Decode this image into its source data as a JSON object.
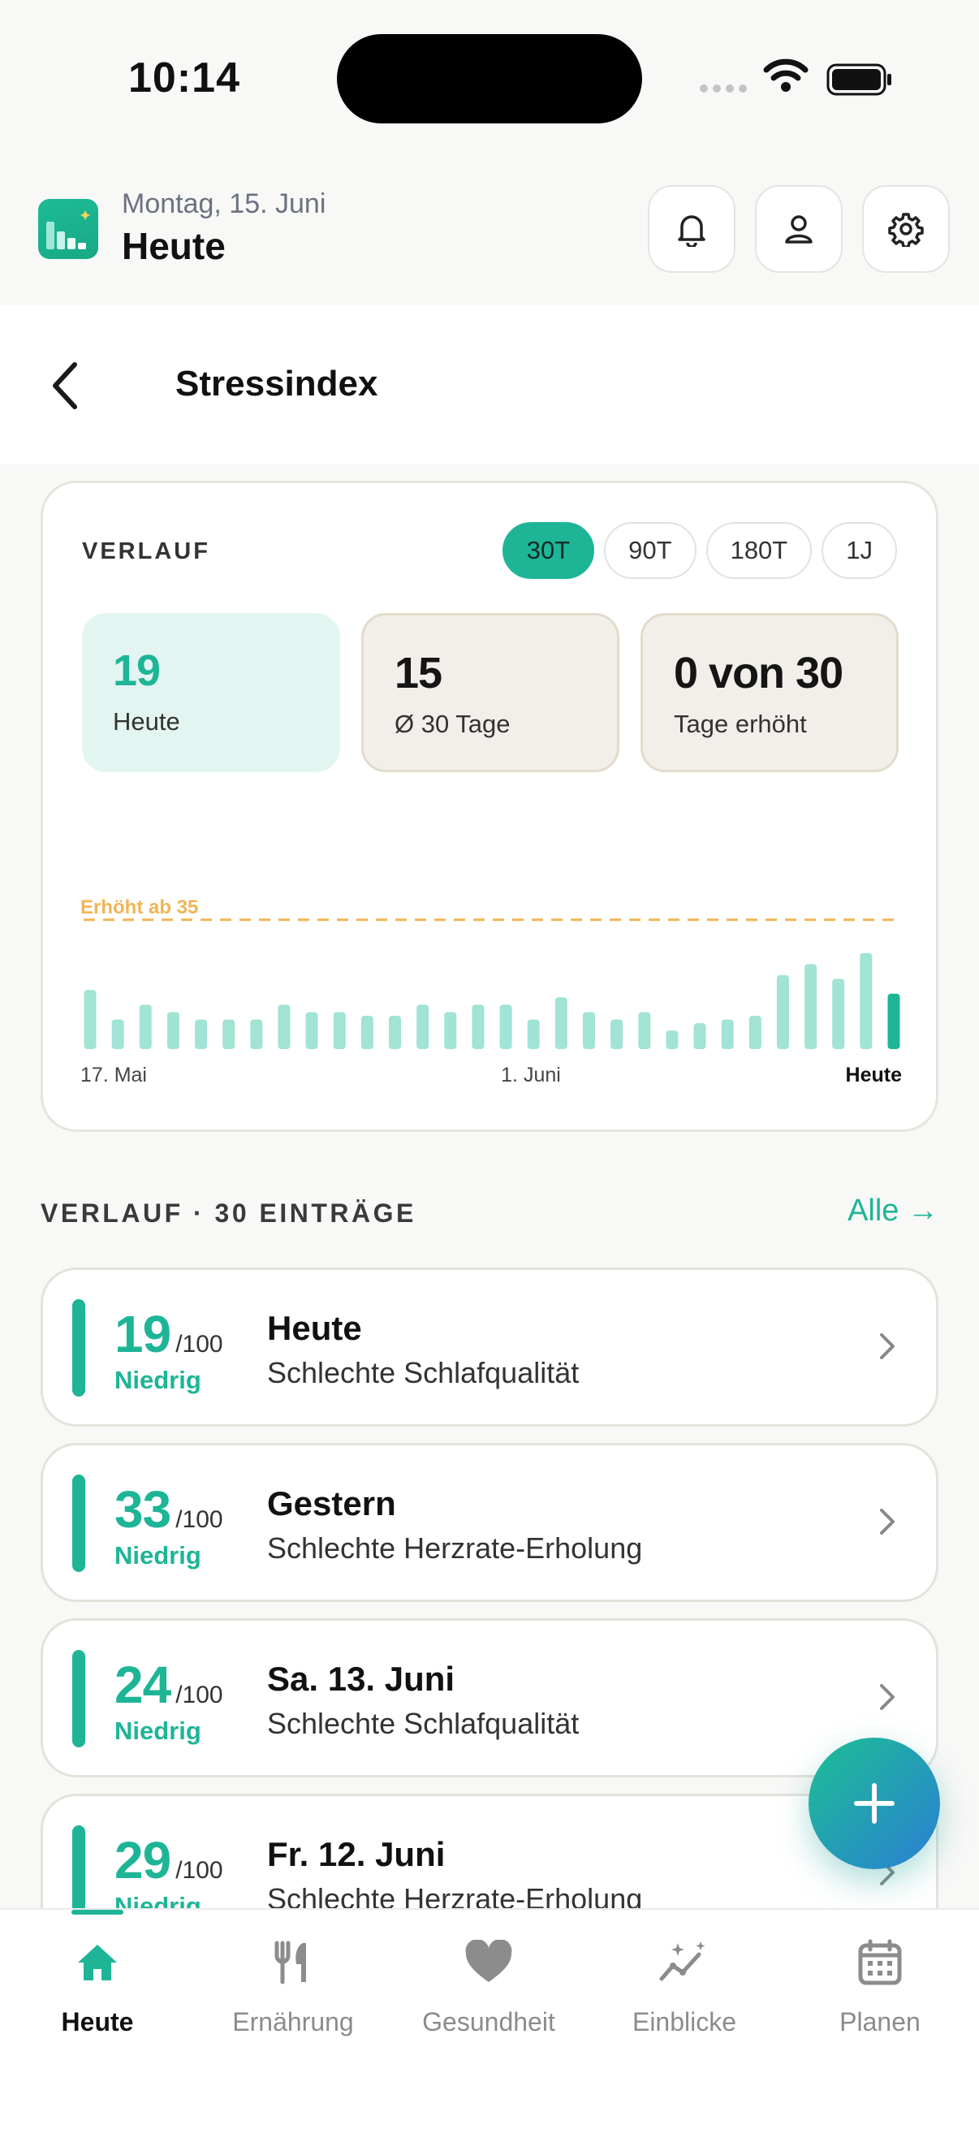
{
  "status_bar": {
    "time": "10:14",
    "icons": [
      "cellular-dots-icon",
      "wifi-icon",
      "battery-icon"
    ]
  },
  "app_header": {
    "date": "Montag, 15. Juni",
    "title": "Heute",
    "icons": [
      "app-logo",
      "bell-icon",
      "user-icon",
      "gear-icon"
    ]
  },
  "sub_header": {
    "title": "Stressindex",
    "back_icon": "chevron-left-icon"
  },
  "history_card": {
    "label": "VERLAUF",
    "ranges": [
      {
        "label": "30T",
        "active": true
      },
      {
        "label": "90T",
        "active": false
      },
      {
        "label": "180T",
        "active": false
      },
      {
        "label": "1J",
        "active": false
      }
    ],
    "stats": [
      {
        "value": "19",
        "label": "Heute"
      },
      {
        "value": "15",
        "label": "Ø 30 Tage"
      },
      {
        "value": "0 von 30",
        "label": "Tage erhöht"
      }
    ]
  },
  "chart_data": {
    "type": "bar",
    "threshold": {
      "value": 35,
      "label": "Erhöht ab 35"
    },
    "x_labels": [
      "17. Mai",
      "1. Juni",
      "Heute"
    ],
    "values": [
      16,
      8,
      12,
      10,
      8,
      8,
      8,
      12,
      10,
      10,
      9,
      9,
      12,
      10,
      12,
      12,
      8,
      14,
      10,
      8,
      10,
      5,
      7,
      8,
      9,
      20,
      23,
      19,
      26,
      15
    ],
    "colors": {
      "bar": "#a1e3d4",
      "today": "#1eb597",
      "threshold": "#f0b556"
    }
  },
  "list": {
    "header": "VERLAUF · 30 EINTRÄGE",
    "all_link": "Alle →",
    "entries": [
      {
        "score": "19",
        "max": "/100",
        "level": "Niedrig",
        "title": "Heute",
        "reason": "Schlechte Schlafqualität"
      },
      {
        "score": "33",
        "max": "/100",
        "level": "Niedrig",
        "title": "Gestern",
        "reason": "Schlechte Herzrate-Erholung"
      },
      {
        "score": "24",
        "max": "/100",
        "level": "Niedrig",
        "title": "Sa. 13. Juni",
        "reason": "Schlechte Schlafqualität"
      },
      {
        "score": "29",
        "max": "/100",
        "level": "Niedrig",
        "title": "Fr. 12. Juni",
        "reason": "Schlechte Herzrate-Erholung"
      }
    ]
  },
  "fab": {
    "icon": "plus-icon"
  },
  "bottom_nav": [
    {
      "label": "Heute",
      "icon": "home-icon",
      "active": true
    },
    {
      "label": "Ernährung",
      "icon": "fork-knife-icon",
      "active": false
    },
    {
      "label": "Gesundheit",
      "icon": "heart-icon",
      "active": false
    },
    {
      "label": "Einblicke",
      "icon": "sparkle-chart-icon",
      "active": false
    },
    {
      "label": "Planen",
      "icon": "calendar-icon",
      "active": false
    }
  ]
}
